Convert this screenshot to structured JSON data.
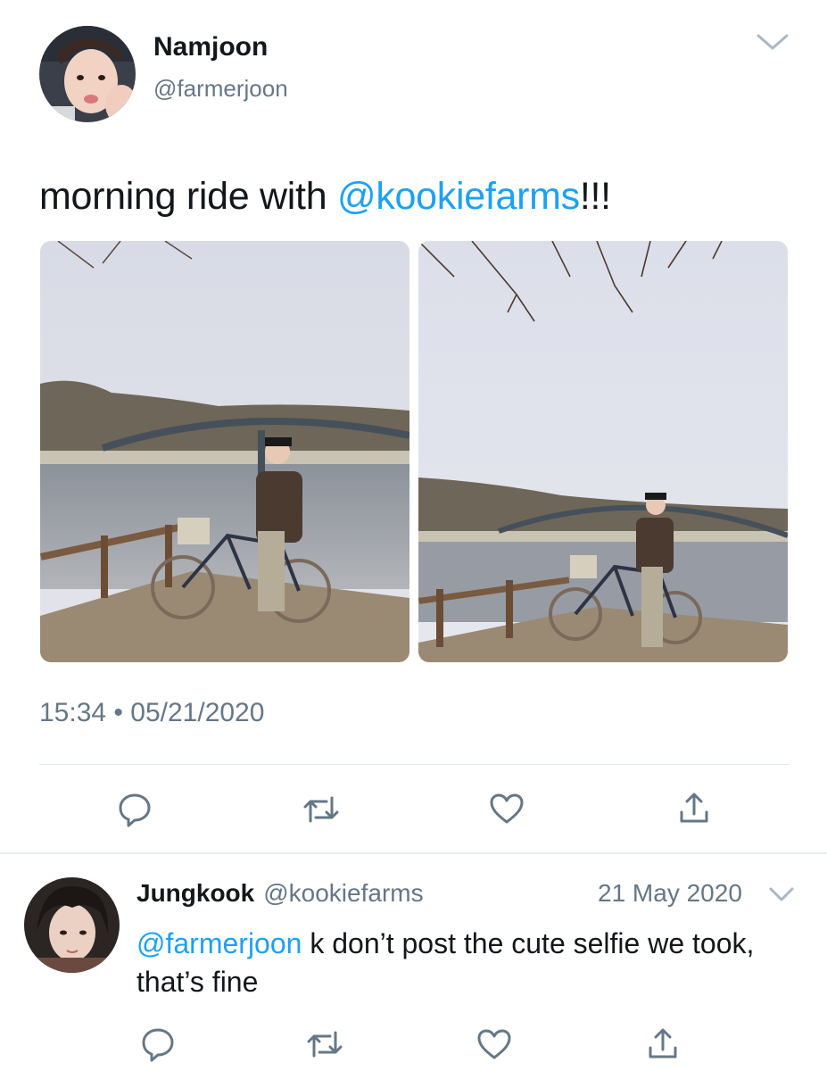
{
  "tweet": {
    "author_name": "Namjoon",
    "author_handle": "@farmerjoon",
    "text_before": "morning ride with ",
    "mention": "@kookiefarms",
    "text_after": "!!!",
    "time": "15:34",
    "separator": "•",
    "date": "05/21/2020",
    "photos": [
      {
        "description_icon": "photo-bike-bridge-wide"
      },
      {
        "description_icon": "photo-bike-bridge-tall-sky"
      }
    ]
  },
  "actions": [
    "reply-icon",
    "retweet-icon",
    "like-icon",
    "share-icon"
  ],
  "reply": {
    "author_name": "Jungkook",
    "author_handle": "@kookiefarms",
    "date": "21 May 2020",
    "mention": "@farmerjoon",
    "text": " k don’t post the cute selfie we took, that’s fine"
  },
  "colors": {
    "link": "#1da1f2",
    "secondary_text": "#657786",
    "primary_text": "#14171a",
    "icon": "#657786",
    "divider": "#e1e8ed"
  }
}
